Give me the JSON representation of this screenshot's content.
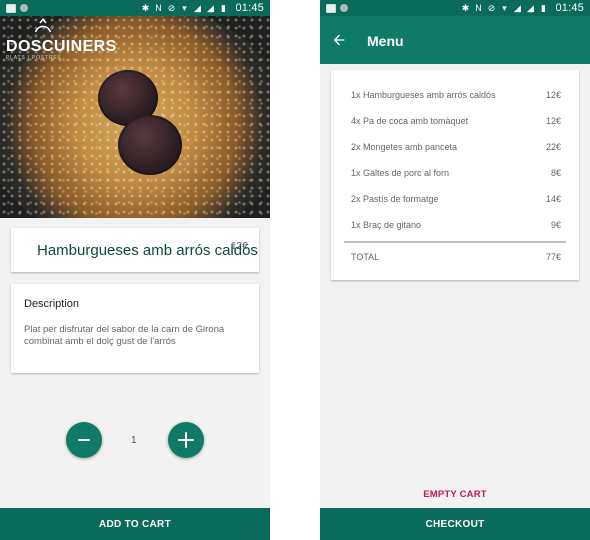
{
  "status_bar": {
    "time": "01:45",
    "left_icons": [
      "image-icon",
      "circle-icon"
    ],
    "right_icons": [
      "bluetooth-icon",
      "nfc-icon",
      "do-not-disturb-icon",
      "wifi-icon",
      "signal-icon",
      "signal-icon",
      "battery-icon"
    ]
  },
  "left_screen": {
    "brand": "DOSCUINERS",
    "brand_subtitle": "PLATS I POSTRES",
    "dish": {
      "title": "Hamburgueses amb arrós caldós",
      "price": "12€"
    },
    "description": {
      "label": "Description",
      "text": "Plat per disfrutar del sabor de la carn de Girona combinat amb el dolç gust de l'arrós"
    },
    "quantity": "1",
    "add_to_cart_label": "ADD TO CART"
  },
  "right_screen": {
    "app_bar": {
      "title": "Menu",
      "back_icon": "arrow-left-icon"
    },
    "cart_items": [
      {
        "label": "1x Hamburgueses amb arrós caldós",
        "price": "12€"
      },
      {
        "label": "4x Pa de coca amb tomàquet",
        "price": "12€"
      },
      {
        "label": "2x Mongetes amb panceta",
        "price": "22€"
      },
      {
        "label": "1x Galtes de porc al forn",
        "price": "8€"
      },
      {
        "label": "2x Pastís de formatge",
        "price": "14€"
      },
      {
        "label": "1x Braç de gitano",
        "price": "9€"
      }
    ],
    "total": {
      "label": "TOTAL",
      "value": "77€"
    },
    "empty_cart_label": "EMPTY CART",
    "checkout_label": "CHECKOUT"
  },
  "colors": {
    "primary_dark": "#0b6b5a",
    "primary": "#0f7a66",
    "accent_pink": "#c2185b",
    "title_text": "#0b4a3f"
  }
}
